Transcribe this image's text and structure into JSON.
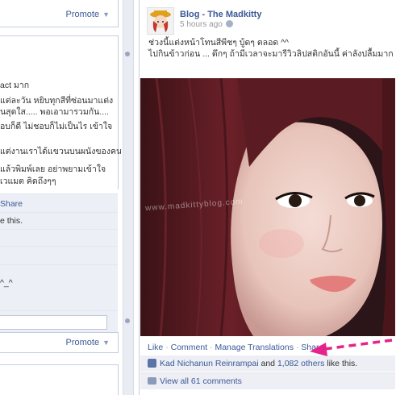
{
  "left_column": {
    "promote_top": "Promote",
    "promote_bottom": "Promote",
    "text_lines": [
      "act มาก",
      "แต่ละวัน หยิบทุกสีที่ซ่อนมาแต่ง",
      "นสุดใส..... พอเอามารวมกัน....",
      "อบก็ดี ไม่ชอบก็ไม่เป็นไร เข้าใจ",
      "แต่งานเราได้แขวนบนผนังของคน",
      "แล้วพิมพ์เลย อย่าพยามเข้าใจ",
      "เวแมต คิดถึงๆๆ"
    ],
    "share_link": "Share",
    "likes_this": "e this.",
    "emoticon": "^_^"
  },
  "post": {
    "page_name": "Blog - The Madkitty",
    "time": "5 hours ago",
    "text_lines": [
      "ช่วงนี้แต่งหน้าโทนสีพีชๆ บู้ดๆ ตลอด ^^",
      "ไปกินข้าวก่อน ... ดึกๆ ถ้ามีเวลาจะมารีวิวลิปสติกอันนี้ ค่าลังปลื้มมาก"
    ],
    "watermark": "www.madkittyblog.com",
    "actions": {
      "like": "Like",
      "comment": "Comment",
      "translations": "Manage Translations",
      "share": "Share",
      "sep": "·"
    },
    "likes": {
      "name": "Kad Nichanun Reinrampai",
      "and": "and",
      "others": "1,082 others",
      "suffix": "like this."
    },
    "comments": "View all 61 comments"
  },
  "colors": {
    "link": "#3b5998",
    "arrow": "#e6238a",
    "feedback_bg": "#edeff4"
  }
}
